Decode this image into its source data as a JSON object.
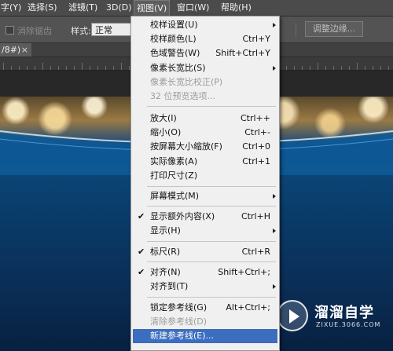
{
  "menubar": {
    "items": [
      {
        "label": "字(Y)"
      },
      {
        "label": "选择(S)"
      },
      {
        "label": "滤镜(T)"
      },
      {
        "label": "3D(D)"
      },
      {
        "label": "视图(V)"
      },
      {
        "label": "窗口(W)"
      },
      {
        "label": "帮助(H)"
      }
    ]
  },
  "options": {
    "antialias_label": "消除锯齿",
    "style_label": "样式:",
    "style_value": "正常",
    "refine_edge_label": "调整边缘..."
  },
  "doc_tab": {
    "title": "/8#)",
    "close": "×"
  },
  "view_menu": {
    "items": [
      {
        "label": "校样设置(U)",
        "shortcut": "",
        "submenu": true,
        "disabled": false,
        "checked": false
      },
      {
        "label": "校样颜色(L)",
        "shortcut": "Ctrl+Y",
        "submenu": false,
        "disabled": false,
        "checked": false
      },
      {
        "label": "色域警告(W)",
        "shortcut": "Shift+Ctrl+Y",
        "submenu": false,
        "disabled": false,
        "checked": false
      },
      {
        "label": "像素长宽比(S)",
        "shortcut": "",
        "submenu": true,
        "disabled": false,
        "checked": false
      },
      {
        "label": "像素长宽比校正(P)",
        "shortcut": "",
        "submenu": false,
        "disabled": true,
        "checked": false
      },
      {
        "label": "32 位预览选项...",
        "shortcut": "",
        "submenu": false,
        "disabled": true,
        "checked": false
      },
      {
        "label": "放大(I)",
        "shortcut": "Ctrl++",
        "submenu": false,
        "disabled": false,
        "checked": false
      },
      {
        "label": "缩小(O)",
        "shortcut": "Ctrl+-",
        "submenu": false,
        "disabled": false,
        "checked": false
      },
      {
        "label": "按屏幕大小缩放(F)",
        "shortcut": "Ctrl+0",
        "submenu": false,
        "disabled": false,
        "checked": false
      },
      {
        "label": "实际像素(A)",
        "shortcut": "Ctrl+1",
        "submenu": false,
        "disabled": false,
        "checked": false
      },
      {
        "label": "打印尺寸(Z)",
        "shortcut": "",
        "submenu": false,
        "disabled": false,
        "checked": false
      },
      {
        "label": "屏幕模式(M)",
        "shortcut": "",
        "submenu": true,
        "disabled": false,
        "checked": false
      },
      {
        "label": "显示额外内容(X)",
        "shortcut": "Ctrl+H",
        "submenu": false,
        "disabled": false,
        "checked": true
      },
      {
        "label": "显示(H)",
        "shortcut": "",
        "submenu": true,
        "disabled": false,
        "checked": false
      },
      {
        "label": "标尺(R)",
        "shortcut": "Ctrl+R",
        "submenu": false,
        "disabled": false,
        "checked": true
      },
      {
        "label": "对齐(N)",
        "shortcut": "Shift+Ctrl+;",
        "submenu": false,
        "disabled": false,
        "checked": true
      },
      {
        "label": "对齐到(T)",
        "shortcut": "",
        "submenu": true,
        "disabled": false,
        "checked": false
      },
      {
        "label": "锁定参考线(G)",
        "shortcut": "Alt+Ctrl+;",
        "submenu": false,
        "disabled": false,
        "checked": false
      },
      {
        "label": "清除参考线(D)",
        "shortcut": "",
        "submenu": false,
        "disabled": true,
        "checked": false
      },
      {
        "label": "新建参考线(E)...",
        "shortcut": "",
        "submenu": false,
        "disabled": false,
        "checked": false,
        "highlighted": true
      }
    ],
    "check_glyph": "✔"
  },
  "watermark": {
    "name": "溜溜自学",
    "url": "ZIXUE.3066.COM"
  },
  "colors": {
    "menubar_bg": "#4b4b4b",
    "menu_bg": "#f0f0f0",
    "highlight": "#3c6dbf",
    "canvas_blue": "#0b4778"
  }
}
